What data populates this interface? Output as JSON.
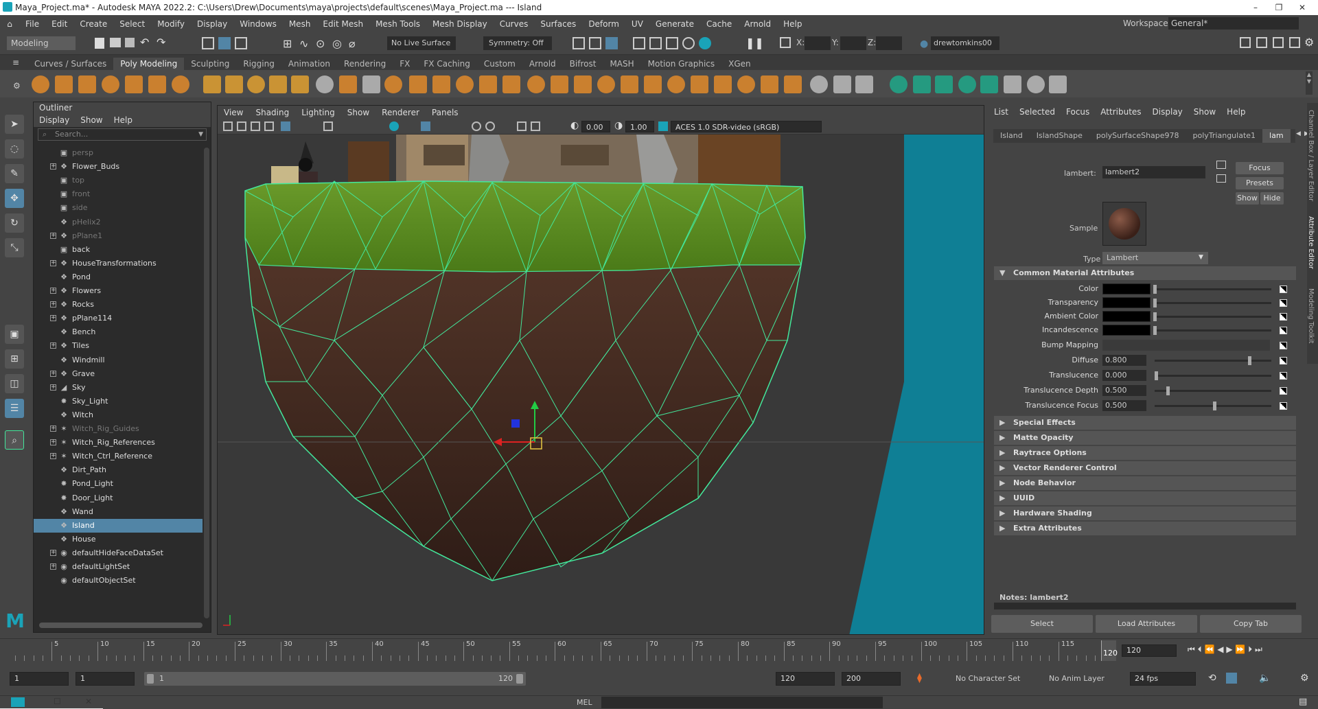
{
  "window": {
    "title": "Maya_Project.ma* - Autodesk MAYA 2022.2: C:\\Users\\Drew\\Documents\\maya\\projects\\default\\scenes\\Maya_Project.ma  ---  Island"
  },
  "menus": [
    "File",
    "Edit",
    "Create",
    "Select",
    "Modify",
    "Display",
    "Windows",
    "Mesh",
    "Edit Mesh",
    "Mesh Tools",
    "Mesh Display",
    "Curves",
    "Surfaces",
    "Deform",
    "UV",
    "Generate",
    "Cache",
    "Arnold",
    "Help"
  ],
  "workspace": {
    "label": "Workspace:",
    "value": "General*"
  },
  "status": {
    "menu_set": "Modeling",
    "live_surface": "No Live Surface",
    "symmetry": "Symmetry: Off",
    "x_label": "X:",
    "y_label": "Y:",
    "z_label": "Z:",
    "user": "drewtomkins00"
  },
  "shelf_tabs": [
    "Curves / Surfaces",
    "Poly Modeling",
    "Sculpting",
    "Rigging",
    "Animation",
    "Rendering",
    "FX",
    "FX Caching",
    "Custom",
    "Arnold",
    "Bifrost",
    "MASH",
    "Motion Graphics",
    "XGen"
  ],
  "outliner": {
    "title": "Outliner",
    "menu": [
      "Display",
      "Show",
      "Help"
    ],
    "search_placeholder": "Search...",
    "items": [
      {
        "label": "persp",
        "icon": "camera-icon",
        "dim": true,
        "expand": false
      },
      {
        "label": "Flower_Buds",
        "icon": "transform-icon",
        "dim": false,
        "expand": true
      },
      {
        "label": "top",
        "icon": "camera-icon",
        "dim": true,
        "expand": false
      },
      {
        "label": "front",
        "icon": "camera-icon",
        "dim": true,
        "expand": false
      },
      {
        "label": "side",
        "icon": "camera-icon",
        "dim": true,
        "expand": false
      },
      {
        "label": "pHelix2",
        "icon": "transform-icon",
        "dim": true,
        "expand": false
      },
      {
        "label": "pPlane1",
        "icon": "transform-icon",
        "dim": true,
        "expand": true
      },
      {
        "label": "back",
        "icon": "camera-icon",
        "dim": false,
        "expand": false
      },
      {
        "label": "HouseTransformations",
        "icon": "transform-icon",
        "dim": false,
        "expand": true
      },
      {
        "label": "Pond",
        "icon": "transform-icon",
        "dim": false,
        "expand": false
      },
      {
        "label": "Flowers",
        "icon": "transform-icon",
        "dim": false,
        "expand": true
      },
      {
        "label": "Rocks",
        "icon": "transform-icon",
        "dim": false,
        "expand": true
      },
      {
        "label": "pPlane114",
        "icon": "transform-icon",
        "dim": false,
        "expand": true
      },
      {
        "label": "Bench",
        "icon": "transform-icon",
        "dim": false,
        "expand": false
      },
      {
        "label": "Tiles",
        "icon": "transform-icon",
        "dim": false,
        "expand": true
      },
      {
        "label": "Windmill",
        "icon": "transform-icon",
        "dim": false,
        "expand": false
      },
      {
        "label": "Grave",
        "icon": "transform-icon",
        "dim": false,
        "expand": true
      },
      {
        "label": "Sky",
        "icon": "sky-icon",
        "dim": false,
        "expand": true
      },
      {
        "label": "Sky_Light",
        "icon": "light-icon",
        "dim": false,
        "expand": false
      },
      {
        "label": "Witch",
        "icon": "transform-icon",
        "dim": false,
        "expand": false
      },
      {
        "label": "Witch_Rig_Guides",
        "icon": "joint-icon",
        "dim": true,
        "expand": true
      },
      {
        "label": "Witch_Rig_References",
        "icon": "joint-icon",
        "dim": false,
        "expand": true
      },
      {
        "label": "Witch_Ctrl_Reference",
        "icon": "joint-icon",
        "dim": false,
        "expand": true
      },
      {
        "label": "Dirt_Path",
        "icon": "transform-icon",
        "dim": false,
        "expand": false
      },
      {
        "label": "Pond_Light",
        "icon": "light-icon",
        "dim": false,
        "expand": false
      },
      {
        "label": "Door_Light",
        "icon": "light-icon",
        "dim": false,
        "expand": false
      },
      {
        "label": "Wand",
        "icon": "transform-icon",
        "dim": false,
        "expand": false
      },
      {
        "label": "Island",
        "icon": "transform-icon",
        "dim": false,
        "expand": false,
        "selected": true
      },
      {
        "label": "House",
        "icon": "transform-icon",
        "dim": false,
        "expand": false
      },
      {
        "label": "defaultHideFaceDataSet",
        "icon": "set-icon",
        "dim": false,
        "expand": true
      },
      {
        "label": "defaultLightSet",
        "icon": "set-icon",
        "dim": false,
        "expand": true
      },
      {
        "label": "defaultObjectSet",
        "icon": "set-icon",
        "dim": false,
        "expand": false
      }
    ]
  },
  "viewport": {
    "menu": [
      "View",
      "Shading",
      "Lighting",
      "Show",
      "Renderer",
      "Panels"
    ],
    "exposure": "0.00",
    "gamma": "1.00",
    "color_space": "ACES 1.0 SDR-video (sRGB)"
  },
  "attribute_editor": {
    "menu": [
      "List",
      "Selected",
      "Focus",
      "Attributes",
      "Display",
      "Show",
      "Help"
    ],
    "tabs": [
      "Island",
      "IslandShape",
      "polySurfaceShape978",
      "polyTriangulate1",
      "lam"
    ],
    "material_label": "lambert:",
    "material_name": "lambert2",
    "focus": "Focus",
    "presets": "Presets",
    "show": "Show",
    "hide": "Hide",
    "sample_label": "Sample",
    "type_label": "Type",
    "type_value": "Lambert",
    "common_section": "Common Material Attributes",
    "attrs": [
      {
        "label": "Color",
        "value": "",
        "slider": 0.0
      },
      {
        "label": "Transparency",
        "value": "",
        "slider": 0.0
      },
      {
        "label": "Ambient Color",
        "value": "",
        "slider": 0.0
      },
      {
        "label": "Incandescence",
        "value": "",
        "slider": 0.0
      },
      {
        "label": "Bump Mapping",
        "value": "",
        "slider": null
      },
      {
        "label": "Diffuse",
        "value": "0.800",
        "slider": 0.8
      },
      {
        "label": "Translucence",
        "value": "0.000",
        "slider": 0.0
      },
      {
        "label": "Translucence Depth",
        "value": "0.500",
        "slider": 0.1
      },
      {
        "label": "Translucence Focus",
        "value": "0.500",
        "slider": 0.5
      }
    ],
    "sections": [
      "Special Effects",
      "Matte Opacity",
      "Raytrace Options",
      "Vector Renderer Control",
      "Node Behavior",
      "UUID",
      "Hardware Shading",
      "Extra Attributes"
    ],
    "notes": "Notes:  lambert2",
    "buttons": [
      "Select",
      "Load Attributes",
      "Copy Tab"
    ]
  },
  "side_tabs": [
    "Channel Box / Layer Editor",
    "Attribute Editor",
    "Modeling Toolkit"
  ],
  "timeline": {
    "ticks": [
      "5",
      "10",
      "15",
      "20",
      "25",
      "30",
      "35",
      "40",
      "45",
      "50",
      "55",
      "60",
      "65",
      "70",
      "75",
      "80",
      "85",
      "90",
      "95",
      "100",
      "105",
      "110",
      "115",
      "120"
    ],
    "current_frame": "120",
    "current_field": "120"
  },
  "range": {
    "start": "1",
    "start2": "1",
    "slider_start": "1",
    "slider_end": "120",
    "end": "120",
    "end2": "200",
    "character_set": "No Character Set",
    "anim_layer": "No Anim Layer",
    "fps": "24 fps"
  },
  "command": {
    "label": "MEL"
  },
  "colors": {
    "accent": "#5285a6",
    "wire": "#43e89c",
    "grass": "#5a8a22",
    "dirt": "#4a3026",
    "water": "#0f7f95"
  }
}
